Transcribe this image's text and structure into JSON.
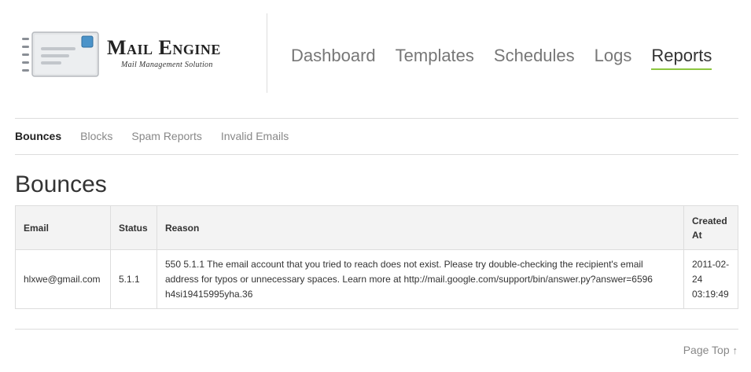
{
  "brand": {
    "title": "Mail Engine",
    "subtitle": "Mail Management Solution"
  },
  "main_nav": [
    {
      "label": "Dashboard",
      "active": false
    },
    {
      "label": "Templates",
      "active": false
    },
    {
      "label": "Schedules",
      "active": false
    },
    {
      "label": "Logs",
      "active": false
    },
    {
      "label": "Reports",
      "active": true
    }
  ],
  "sub_nav": [
    {
      "label": "Bounces",
      "active": true
    },
    {
      "label": "Blocks",
      "active": false
    },
    {
      "label": "Spam Reports",
      "active": false
    },
    {
      "label": "Invalid Emails",
      "active": false
    }
  ],
  "page": {
    "title": "Bounces"
  },
  "table": {
    "headers": {
      "email": "Email",
      "status": "Status",
      "reason": "Reason",
      "created": "Created At"
    },
    "rows": [
      {
        "email": "hlxwe@gmail.com",
        "status": "5.1.1",
        "reason": "550 5.1.1 The email account that you tried to reach does not exist. Please try double-checking the recipient's email address for typos or unnecessary spaces. Learn more at http://mail.google.com/support/bin/answer.py?answer=6596 h4si19415995yha.36",
        "created": "2011-02-24 03:19:49"
      }
    ]
  },
  "footer": {
    "page_top": "Page Top",
    "page_top_icon": "arrow-up-icon"
  },
  "colors": {
    "active_underline": "#8cc63f",
    "rule": "#dddddd",
    "header_bg": "#f3f3f3"
  }
}
